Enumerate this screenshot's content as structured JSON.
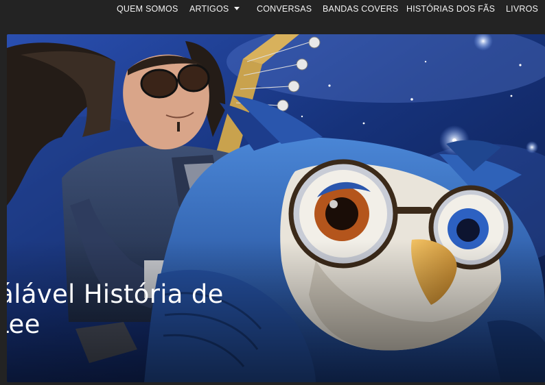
{
  "nav": {
    "items": [
      {
        "label": "QUEM SOMOS",
        "dropdown": false
      },
      {
        "label": "ARTIGOS",
        "dropdown": true
      },
      {
        "label": "CONVERSAS",
        "dropdown": false
      },
      {
        "label": "BANDAS COVERS",
        "dropdown": false
      },
      {
        "label": "HISTÓRIAS DOS FÃS",
        "dropdown": false
      },
      {
        "label": "LIVROS",
        "dropdown": false
      }
    ],
    "dropdown_icon": "chevron-down-icon"
  },
  "hero": {
    "title_line1": "ruálável História de",
    "title_line2": "y Lee",
    "image_subject": "man with long hair and round glasses holding a bass guitar next to a large blue owl with round glasses",
    "colors": {
      "sky": "#16327a",
      "owl_blue": "#2c5fae",
      "jacket": "#2f3f62"
    }
  }
}
